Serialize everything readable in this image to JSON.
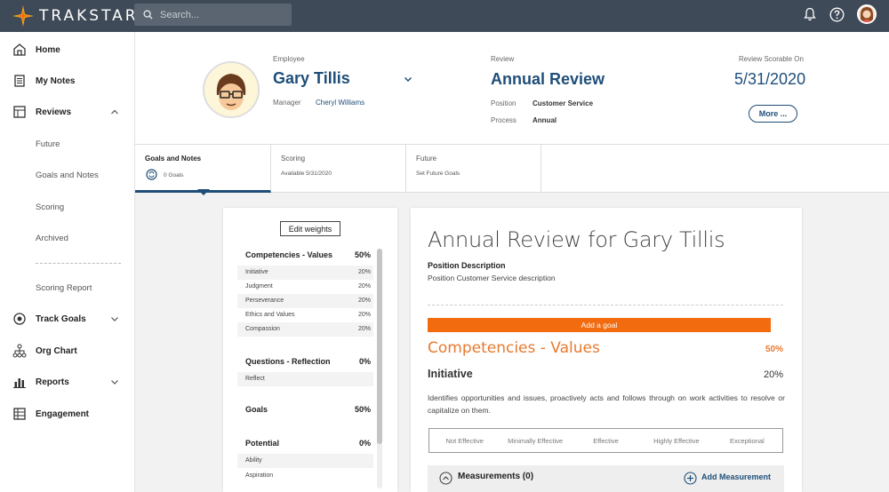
{
  "app": {
    "brand": "TRAKSTAR"
  },
  "search": {
    "placeholder": "Search..."
  },
  "topbar_icons": [
    "search-icon",
    "bell-icon",
    "help-icon",
    "user-avatar"
  ],
  "sidebar": {
    "items": [
      {
        "label": "Home",
        "icon": "home-icon"
      },
      {
        "label": "My Notes",
        "icon": "notes-icon"
      },
      {
        "label": "Reviews",
        "icon": "reviews-icon",
        "expanded": true
      },
      {
        "label": "Future"
      },
      {
        "label": "Goals and Notes"
      },
      {
        "label": "Scoring"
      },
      {
        "label": "Archived"
      },
      {
        "label": "Scoring Report"
      },
      {
        "label": "Track Goals",
        "icon": "target-icon"
      },
      {
        "label": "Org Chart",
        "icon": "org-chart-icon"
      },
      {
        "label": "Reports",
        "icon": "reports-icon"
      },
      {
        "label": "Engagement",
        "icon": "engagement-icon"
      }
    ]
  },
  "header": {
    "employee_label": "Employee",
    "employee_name": "Gary Tillis",
    "manager_label": "Manager",
    "manager_name": "Cheryl Williams",
    "review_label": "Review",
    "review_name": "Annual Review",
    "position_label": "Position",
    "position_value": "Customer Service",
    "process_label": "Process",
    "process_value": "Annual",
    "scorable_label": "Review Scorable On",
    "scorable_date": "5/31/2020",
    "more_label": "More ..."
  },
  "tabs": [
    {
      "title": "Goals and Notes",
      "sub": "0 Goals",
      "active": true
    },
    {
      "title": "Scoring",
      "sub": "Available 5/31/2020"
    },
    {
      "title": "Future",
      "sub": "Set Future Goals"
    }
  ],
  "weights": {
    "edit_label": "Edit weights",
    "sections": [
      {
        "name": "Competencies - Values",
        "pct": "50%",
        "rows": [
          {
            "name": "Initiative",
            "pct": "20%"
          },
          {
            "name": "Judgment",
            "pct": "20%"
          },
          {
            "name": "Perseverance",
            "pct": "20%"
          },
          {
            "name": "Ethics and Values",
            "pct": "20%"
          },
          {
            "name": "Compassion",
            "pct": "20%"
          }
        ]
      },
      {
        "name": "Questions - Reflection",
        "pct": "0%",
        "rows": [
          {
            "name": "Reflect",
            "pct": ""
          }
        ]
      },
      {
        "name": "Goals",
        "pct": "50%",
        "rows": []
      },
      {
        "name": "Potential",
        "pct": "0%",
        "rows": [
          {
            "name": "Ability",
            "pct": ""
          },
          {
            "name": "Aspiration",
            "pct": ""
          }
        ]
      }
    ]
  },
  "main": {
    "title": "Annual Review for Gary Tillis",
    "position_desc_label": "Position Description",
    "position_desc": "Position Customer Service description",
    "add_goal_label": "Add a goal",
    "competency_title": "Competencies - Values",
    "competency_pct": "50%",
    "item_title": "Initiative",
    "item_pct": "20%",
    "item_desc": "Identifies opportunities and issues, proactively acts and follows through on work activities to resolve or capitalize on them.",
    "scale": [
      "Not Effective",
      "Minimally Effective",
      "Effective",
      "Highly Effective",
      "Exceptional"
    ],
    "measurements_label": "Measurements (0)",
    "add_measurement_label": "Add Measurement"
  },
  "colors": {
    "topbar": "#3e4a57",
    "primary": "#1f4e79",
    "accent": "#f26b0f",
    "competency": "#e87a2c"
  }
}
